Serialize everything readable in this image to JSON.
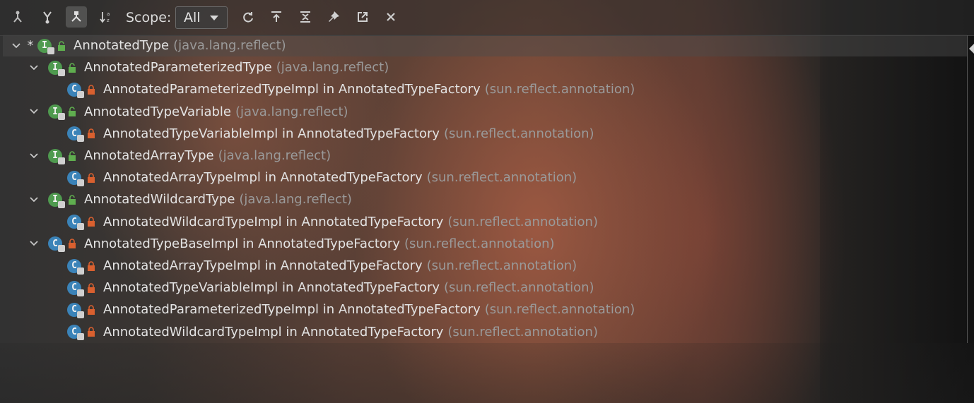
{
  "toolbar": {
    "buttons": [
      {
        "icon": "supertypes-hierarchy-icon",
        "active": false
      },
      {
        "icon": "subtypes-hierarchy-icon",
        "active": false
      },
      {
        "icon": "class-hierarchy-icon",
        "active": true
      },
      {
        "icon": "sort-alphabetically-icon",
        "active": false
      }
    ],
    "scope_label": "Scope:",
    "scope_value": "All",
    "actions": [
      "refresh-icon",
      "autoscroll-to-source-icon",
      "collapse-all-icon",
      "pin-icon",
      "open-in-window-icon",
      "close-icon"
    ]
  },
  "tree": {
    "root": {
      "name": "AnnotatedType",
      "package": "(java.lang.reflect)",
      "marker": "*",
      "kind": "interface"
    },
    "rows": [
      {
        "depth": 1,
        "expandable": true,
        "kind": "interface",
        "access": "public",
        "name": "AnnotatedParameterizedType",
        "package": "(java.lang.reflect)"
      },
      {
        "depth": 2,
        "expandable": false,
        "kind": "class",
        "access": "private",
        "name": "AnnotatedParameterizedTypeImpl in AnnotatedTypeFactory",
        "package": "(sun.reflect.annotation)"
      },
      {
        "depth": 1,
        "expandable": true,
        "kind": "interface",
        "access": "public",
        "name": "AnnotatedTypeVariable",
        "package": "(java.lang.reflect)"
      },
      {
        "depth": 2,
        "expandable": false,
        "kind": "class",
        "access": "private",
        "name": "AnnotatedTypeVariableImpl in AnnotatedTypeFactory",
        "package": "(sun.reflect.annotation)"
      },
      {
        "depth": 1,
        "expandable": true,
        "kind": "interface",
        "access": "public",
        "name": "AnnotatedArrayType",
        "package": "(java.lang.reflect)"
      },
      {
        "depth": 2,
        "expandable": false,
        "kind": "class",
        "access": "private",
        "name": "AnnotatedArrayTypeImpl in AnnotatedTypeFactory",
        "package": "(sun.reflect.annotation)"
      },
      {
        "depth": 1,
        "expandable": true,
        "kind": "interface",
        "access": "public",
        "name": "AnnotatedWildcardType",
        "package": "(java.lang.reflect)"
      },
      {
        "depth": 2,
        "expandable": false,
        "kind": "class",
        "access": "private",
        "name": "AnnotatedWildcardTypeImpl in AnnotatedTypeFactory",
        "package": "(sun.reflect.annotation)"
      },
      {
        "depth": 1,
        "expandable": true,
        "kind": "class",
        "access": "private",
        "name": "AnnotatedTypeBaseImpl in AnnotatedTypeFactory",
        "package": "(sun.reflect.annotation)"
      },
      {
        "depth": 2,
        "expandable": false,
        "kind": "class",
        "access": "private",
        "name": "AnnotatedArrayTypeImpl in AnnotatedTypeFactory",
        "package": "(sun.reflect.annotation)"
      },
      {
        "depth": 2,
        "expandable": false,
        "kind": "class",
        "access": "private",
        "name": "AnnotatedTypeVariableImpl in AnnotatedTypeFactory",
        "package": "(sun.reflect.annotation)"
      },
      {
        "depth": 2,
        "expandable": false,
        "kind": "class",
        "access": "private",
        "name": "AnnotatedParameterizedTypeImpl in AnnotatedTypeFactory",
        "package": "(sun.reflect.annotation)"
      },
      {
        "depth": 2,
        "expandable": false,
        "kind": "class",
        "access": "private",
        "name": "AnnotatedWildcardTypeImpl in AnnotatedTypeFactory",
        "package": "(sun.reflect.annotation)"
      }
    ]
  },
  "colors": {
    "interface_badge": "#4f9a4f",
    "class_badge": "#3b83b8",
    "public_access": "#5fae4f",
    "private_access": "#d9602f"
  }
}
